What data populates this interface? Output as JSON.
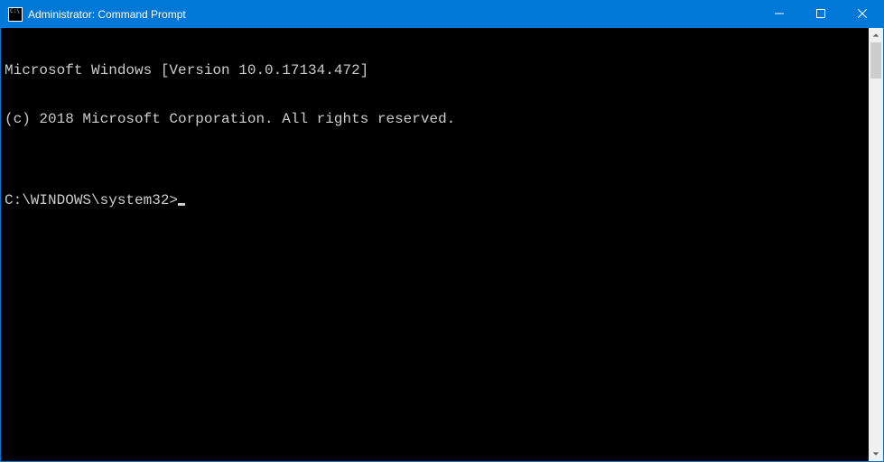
{
  "window": {
    "title": "Administrator: Command Prompt"
  },
  "terminal": {
    "line1": "Microsoft Windows [Version 10.0.17134.472]",
    "line2": "(c) 2018 Microsoft Corporation. All rights reserved.",
    "blank": "",
    "prompt": "C:\\WINDOWS\\system32>"
  }
}
